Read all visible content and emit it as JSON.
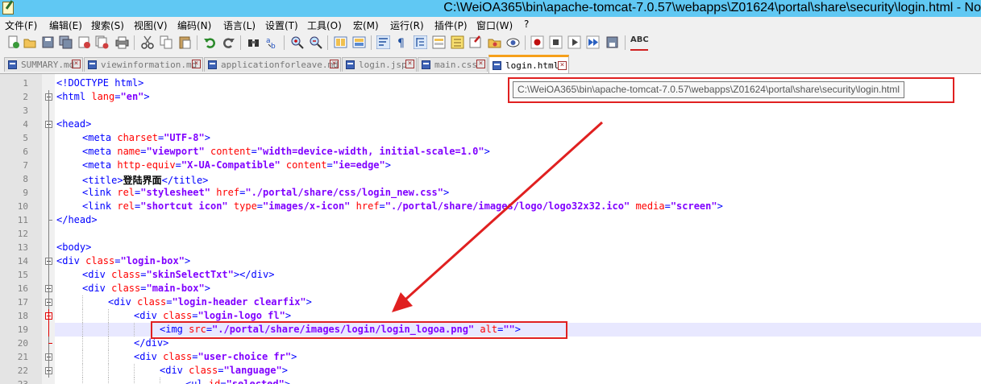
{
  "window": {
    "title": "C:\\WeiOA365\\bin\\apache-tomcat-7.0.57\\webapps\\Z01624\\portal\\share\\security\\login.html - No"
  },
  "menu": [
    "文件(F)",
    "编辑(E)",
    "搜索(S)",
    "视图(V)",
    "编码(N)",
    "语言(L)",
    "设置(T)",
    "工具(O)",
    "宏(M)",
    "运行(R)",
    "插件(P)",
    "窗口(W)",
    "?"
  ],
  "toolbar": {
    "icons": [
      "new-file-icon",
      "open-file-icon",
      "save-icon",
      "save-all-icon",
      "close-icon",
      "close-all-icon",
      "print-icon",
      "cut-icon",
      "copy-icon",
      "paste-icon",
      "undo-icon",
      "redo-icon",
      "find-icon",
      "replace-icon",
      "zoom-in-icon",
      "zoom-out-icon",
      "sync-vertical-icon",
      "sync-horizontal-icon",
      "word-wrap-icon",
      "show-all-chars-icon",
      "indent-guide-icon",
      "document-map-icon",
      "function-list-icon",
      "folder-as-workspace-icon",
      "monitoring-icon",
      "record-macro-icon",
      "stop-macro-icon",
      "play-macro-icon",
      "run-macro-multiple-icon",
      "save-macro-icon",
      "spell-check-icon"
    ],
    "spell_label": "ABC"
  },
  "tabs": [
    {
      "label": "SUMMARY.md",
      "active": false
    },
    {
      "label": "viewinformation.md",
      "active": false
    },
    {
      "label": "applicationforleave.md",
      "active": false
    },
    {
      "label": "login.jsp",
      "active": false
    },
    {
      "label": "main.css",
      "active": false
    },
    {
      "label": "login.html",
      "active": true
    }
  ],
  "tab_close_glyph": "×",
  "tooltip": {
    "text": "C:\\WeiOA365\\bin\\apache-tomcat-7.0.57\\webapps\\Z01624\\portal\\share\\security\\login.html"
  },
  "editor": {
    "current_line": 19,
    "lines": [
      {
        "n": "1",
        "indent": 0,
        "parts": [
          [
            "t",
            "<!DOCTYPE html>"
          ]
        ]
      },
      {
        "n": "2",
        "indent": 0,
        "parts": [
          [
            "t",
            "<html "
          ],
          [
            "a",
            "lang"
          ],
          [
            "t",
            "="
          ],
          [
            "v",
            "\"en\""
          ],
          [
            "t",
            ">"
          ]
        ]
      },
      {
        "n": "3",
        "indent": 0,
        "parts": []
      },
      {
        "n": "4",
        "indent": 0,
        "parts": [
          [
            "t",
            "<head>"
          ]
        ]
      },
      {
        "n": "5",
        "indent": 1,
        "parts": [
          [
            "t",
            "<meta "
          ],
          [
            "a",
            "charset"
          ],
          [
            "t",
            "="
          ],
          [
            "v",
            "\"UTF-8\""
          ],
          [
            "t",
            ">"
          ]
        ]
      },
      {
        "n": "6",
        "indent": 1,
        "parts": [
          [
            "t",
            "<meta "
          ],
          [
            "a",
            "name"
          ],
          [
            "t",
            "="
          ],
          [
            "v",
            "\"viewport\""
          ],
          [
            "t",
            " "
          ],
          [
            "a",
            "content"
          ],
          [
            "t",
            "="
          ],
          [
            "v",
            "\"width=device-width, initial-scale=1.0\""
          ],
          [
            "t",
            ">"
          ]
        ]
      },
      {
        "n": "7",
        "indent": 1,
        "parts": [
          [
            "t",
            "<meta "
          ],
          [
            "a",
            "http-equiv"
          ],
          [
            "t",
            "="
          ],
          [
            "v",
            "\"X-UA-Compatible\""
          ],
          [
            "t",
            " "
          ],
          [
            "a",
            "content"
          ],
          [
            "t",
            "="
          ],
          [
            "v",
            "\"ie=edge\""
          ],
          [
            "t",
            ">"
          ]
        ]
      },
      {
        "n": "8",
        "indent": 1,
        "parts": [
          [
            "t",
            "<title>"
          ],
          [
            "tx",
            "登陆界面"
          ],
          [
            "t",
            "</title>"
          ]
        ]
      },
      {
        "n": "9",
        "indent": 1,
        "parts": [
          [
            "t",
            "<link "
          ],
          [
            "a",
            "rel"
          ],
          [
            "t",
            "="
          ],
          [
            "v",
            "\"stylesheet\""
          ],
          [
            "t",
            " "
          ],
          [
            "a",
            "href"
          ],
          [
            "t",
            "="
          ],
          [
            "v",
            "\"./portal/share/css/login_new.css\""
          ],
          [
            "t",
            ">"
          ]
        ]
      },
      {
        "n": "10",
        "indent": 1,
        "parts": [
          [
            "t",
            "<link "
          ],
          [
            "a",
            "rel"
          ],
          [
            "t",
            "="
          ],
          [
            "v",
            "\"shortcut icon\""
          ],
          [
            "t",
            " "
          ],
          [
            "a",
            "type"
          ],
          [
            "t",
            "="
          ],
          [
            "v",
            "\"images/x-icon\""
          ],
          [
            "t",
            " "
          ],
          [
            "a",
            "href"
          ],
          [
            "t",
            "="
          ],
          [
            "v",
            "\"./portal/share/images/logo/logo32x32.ico\""
          ],
          [
            "t",
            " "
          ],
          [
            "a",
            "media"
          ],
          [
            "t",
            "="
          ],
          [
            "v",
            "\"screen\""
          ],
          [
            "t",
            ">"
          ]
        ]
      },
      {
        "n": "11",
        "indent": 0,
        "parts": [
          [
            "t",
            "</head>"
          ]
        ]
      },
      {
        "n": "12",
        "indent": 0,
        "parts": []
      },
      {
        "n": "13",
        "indent": 0,
        "parts": [
          [
            "t",
            "<body>"
          ]
        ]
      },
      {
        "n": "14",
        "indent": 0,
        "parts": [
          [
            "t",
            "<div "
          ],
          [
            "a",
            "class"
          ],
          [
            "t",
            "="
          ],
          [
            "v",
            "\"login-box\""
          ],
          [
            "t",
            ">"
          ]
        ]
      },
      {
        "n": "15",
        "indent": 1,
        "parts": [
          [
            "t",
            "<div "
          ],
          [
            "a",
            "class"
          ],
          [
            "t",
            "="
          ],
          [
            "v",
            "\"skinSelectTxt\""
          ],
          [
            "t",
            "></div>"
          ]
        ]
      },
      {
        "n": "16",
        "indent": 1,
        "parts": [
          [
            "t",
            "<div "
          ],
          [
            "a",
            "class"
          ],
          [
            "t",
            "="
          ],
          [
            "v",
            "\"main-box\""
          ],
          [
            "t",
            ">"
          ]
        ]
      },
      {
        "n": "17",
        "indent": 2,
        "parts": [
          [
            "t",
            "<div "
          ],
          [
            "a",
            "class"
          ],
          [
            "t",
            "="
          ],
          [
            "v",
            "\"login-header clearfix\""
          ],
          [
            "t",
            ">"
          ]
        ]
      },
      {
        "n": "18",
        "indent": 3,
        "parts": [
          [
            "t",
            "<div "
          ],
          [
            "a",
            "class"
          ],
          [
            "t",
            "="
          ],
          [
            "v",
            "\"login-logo fl\""
          ],
          [
            "t",
            ">"
          ]
        ]
      },
      {
        "n": "19",
        "indent": 4,
        "parts": [
          [
            "t",
            "<img "
          ],
          [
            "a",
            "src"
          ],
          [
            "t",
            "="
          ],
          [
            "v",
            "\"./portal/share/images/login/login_logoa.png\""
          ],
          [
            "t",
            " "
          ],
          [
            "a",
            "alt"
          ],
          [
            "t",
            "="
          ],
          [
            "v",
            "\"\""
          ],
          [
            "t",
            ">"
          ]
        ]
      },
      {
        "n": "20",
        "indent": 3,
        "parts": [
          [
            "t",
            "</div>"
          ]
        ]
      },
      {
        "n": "21",
        "indent": 3,
        "parts": [
          [
            "t",
            "<div "
          ],
          [
            "a",
            "class"
          ],
          [
            "t",
            "="
          ],
          [
            "v",
            "\"user-choice fr\""
          ],
          [
            "t",
            ">"
          ]
        ]
      },
      {
        "n": "22",
        "indent": 4,
        "parts": [
          [
            "t",
            "<div "
          ],
          [
            "a",
            "class"
          ],
          [
            "t",
            "="
          ],
          [
            "v",
            "\"language\""
          ],
          [
            "t",
            ">"
          ]
        ]
      },
      {
        "n": "23",
        "indent": 5,
        "parts": [
          [
            "t",
            "<ul "
          ],
          [
            "a",
            "id"
          ],
          [
            "t",
            "="
          ],
          [
            "v",
            "\"selected\""
          ],
          [
            "t",
            ">"
          ]
        ]
      }
    ]
  },
  "annotation": {
    "color": "#e02020"
  }
}
